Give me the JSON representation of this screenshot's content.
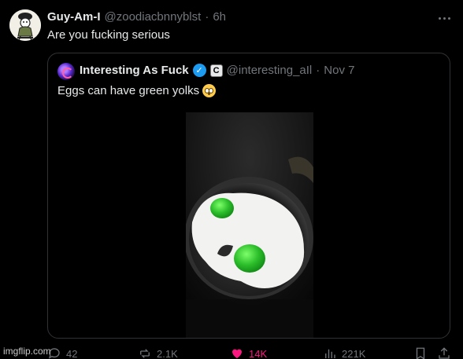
{
  "tweet": {
    "display_name": "Guy-Am-I",
    "handle": "@zoodiacbnnyblst",
    "separator": "·",
    "time": "6h",
    "text": "Are you fucking serious",
    "avatar_icon": "cartoon-character-avatar"
  },
  "quote": {
    "display_name": "Interesting As Fuck",
    "verified_icon": "verified-badge-icon",
    "affiliate_badge": "C",
    "handle": "@interesting_aIl",
    "separator": "·",
    "date": "Nov 7",
    "text": "Eggs can have green yolks",
    "emoji": "flushed-face-emoji",
    "media": "fried-eggs-with-green-yolks-in-pan"
  },
  "actions": {
    "replies": "42",
    "reposts": "2.1K",
    "likes": "14K",
    "views": "221K"
  },
  "colors": {
    "background": "#000000",
    "text": "#e7e9ea",
    "muted": "#71767b",
    "verified": "#1d9bf0",
    "liked": "#f91880",
    "border": "#2f3336"
  },
  "watermark": "imgflip.com"
}
